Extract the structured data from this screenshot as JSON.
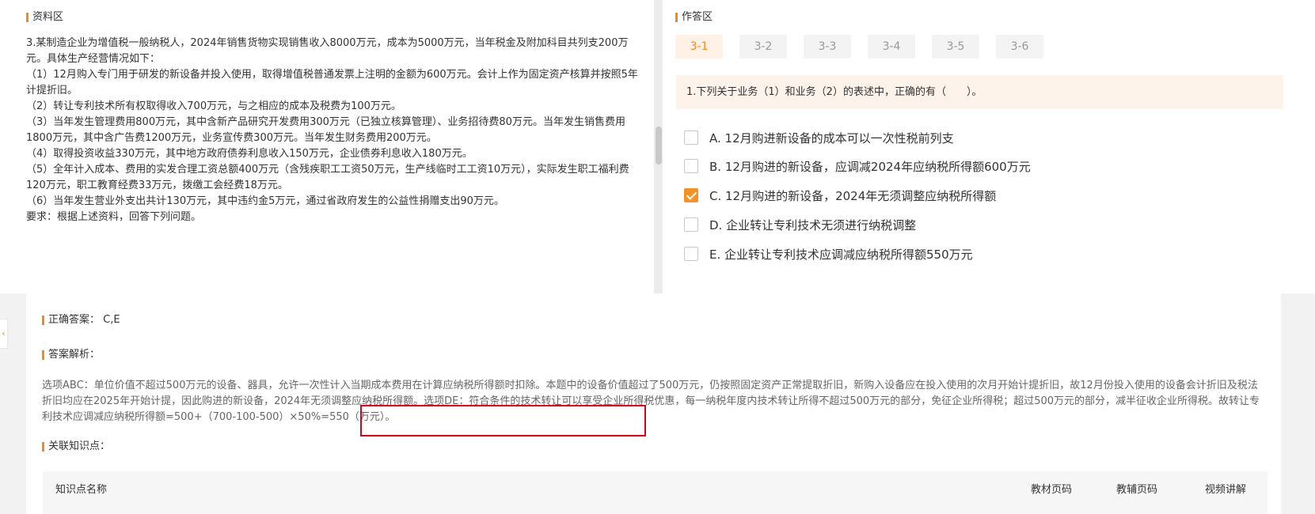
{
  "material_section": {
    "title": "资料区",
    "paragraphs": [
      "3.某制造企业为增值税一般纳税人，2024年销售货物实现销售收入8000万元，成本为5000万元，当年税金及附加科目共列支200万元。具体生产经营情况如下：",
      "（1）12月购入专门用于研发的新设备并投入使用，取得增值税普通发票上注明的金额为600万元。会计上作为固定资产核算并按照5年计提折旧。",
      "（2）转让专利技术所有权取得收入700万元，与之相应的成本及税费为100万元。",
      "（3）当年发生管理费用800万元，其中含新产品研究开发费用300万元（已独立核算管理）、业务招待费80万元。当年发生销售费用1800万元，其中含广告费1200万元，业务宣传费300万元。当年发生财务费用200万元。",
      "（4）取得投资收益330万元，其中地方政府债券利息收入150万元，企业债券利息收入180万元。",
      "（5）全年计入成本、费用的实发合理工资总额400万元（含残疾职工工资50万元，生产线临时工工资10万元），实际发生职工福利费120万元，职工教育经费33万元，拨缴工会经费18万元。",
      "（6）当年发生营业外支出共计130万元，其中违约金5万元，通过省政府发生的公益性捐赠支出90万元。",
      "要求：根据上述资料，回答下列问题。"
    ]
  },
  "answer_section": {
    "title": "作答区",
    "tabs": [
      "3-1",
      "3-2",
      "3-3",
      "3-4",
      "3-5",
      "3-6"
    ],
    "active_tab": "3-1",
    "question": "1.下列关于业务（1）和业务（2）的表述中，正确的有（　　）。",
    "options": [
      {
        "label": "A. 12月购进新设备的成本可以一次性税前列支",
        "checked": false
      },
      {
        "label": "B. 12月购进的新设备，应调减2024年应纳税所得额600万元",
        "checked": false
      },
      {
        "label": "C. 12月购进的新设备，2024年无须调整应纳税所得额",
        "checked": true
      },
      {
        "label": "D. 企业转让专利技术无须进行纳税调整",
        "checked": false
      },
      {
        "label": "E. 企业转让专利技术应调减应纳税所得额550万元",
        "checked": false
      }
    ]
  },
  "result_section": {
    "correct_label": "正确答案：",
    "correct_value": "C,E",
    "analysis_label": "答案解析：",
    "analysis_text": "选项ABC：单位价值不超过500万元的设备、器具，允许一次性计入当期成本费用在计算应纳税所得额时扣除。本题中的设备价值超过了500万元，仍按照固定资产正常提取折旧，新购入设备应在投入使用的次月开始计提折旧，故12月份投入使用的设备会计折旧及税法折旧均应在2025年开始计提，因此购进的新设备，2024年无须调整应纳税所得额。选项DE：符合条件的技术转让可以享受企业所得税优惠，每一纳税年度内技术转让所得不超过500万元的部分，免征企业所得税；超过500万元的部分，减半征收企业所得税。故转让专利技术应调减应纳税所得额=500+（700-100-500）×50%=550（万元）。",
    "knowledge_label": "关联知识点：",
    "table_headers": {
      "name": "知识点名称",
      "textbook_page": "教材页码",
      "guide_page": "教辅页码",
      "video": "视频讲解"
    }
  },
  "colors": {
    "accent": "#f08a24",
    "highlight_box": "#d9001b"
  }
}
